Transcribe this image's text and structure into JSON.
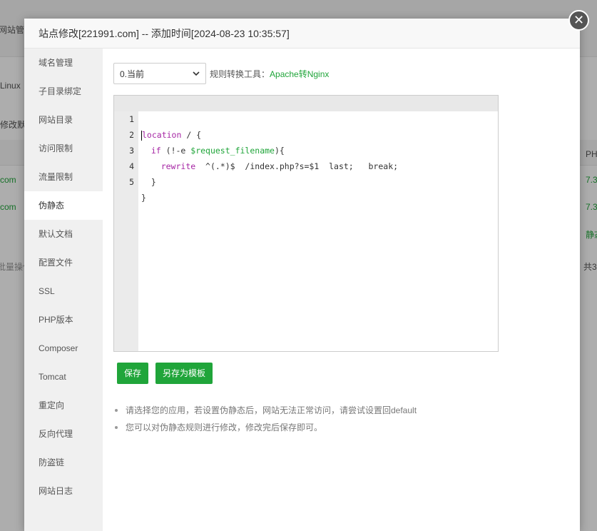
{
  "background": {
    "items": [
      "网站管",
      "Linux",
      "修改默",
      "com",
      "com",
      "批量操作",
      "PH",
      "7.3",
      "7.3",
      "静态",
      "共3"
    ]
  },
  "modal": {
    "title": "站点修改[221991.com] -- 添加时间[2024-08-23 10:35:57]",
    "close_symbol": "✕"
  },
  "sidebar": {
    "items": [
      {
        "label": "域名管理"
      },
      {
        "label": "子目录绑定"
      },
      {
        "label": "网站目录"
      },
      {
        "label": "访问限制"
      },
      {
        "label": "流量限制"
      },
      {
        "label": "伪静态"
      },
      {
        "label": "默认文档"
      },
      {
        "label": "配置文件"
      },
      {
        "label": "SSL"
      },
      {
        "label": "PHP版本"
      },
      {
        "label": "Composer"
      },
      {
        "label": "Tomcat"
      },
      {
        "label": "重定向"
      },
      {
        "label": "反向代理"
      },
      {
        "label": "防盗链"
      },
      {
        "label": "网站日志"
      }
    ],
    "active_index": 5
  },
  "toolbar": {
    "select_value": "0.当前",
    "converter_label": "规则转换工具：",
    "converter_link": "Apache转Nginx"
  },
  "editor": {
    "lines": [
      {
        "num": "1",
        "code": "location / {"
      },
      {
        "num": "2",
        "code": "  if (!-e $request_filename){"
      },
      {
        "num": "3",
        "code": "    rewrite  ^(.*)$  /index.php?s=$1  last;   break;"
      },
      {
        "num": "4",
        "code": "  }"
      },
      {
        "num": "5",
        "code": "}"
      }
    ]
  },
  "buttons": {
    "save": "保存",
    "save_template": "另存为模板"
  },
  "tips": [
    "请选择您的应用，若设置伪静态后，网站无法正常访问，请尝试设置回default",
    "您可以对伪静态规则进行修改，修改完后保存即可。"
  ],
  "colors": {
    "accent": "#20a53a"
  }
}
